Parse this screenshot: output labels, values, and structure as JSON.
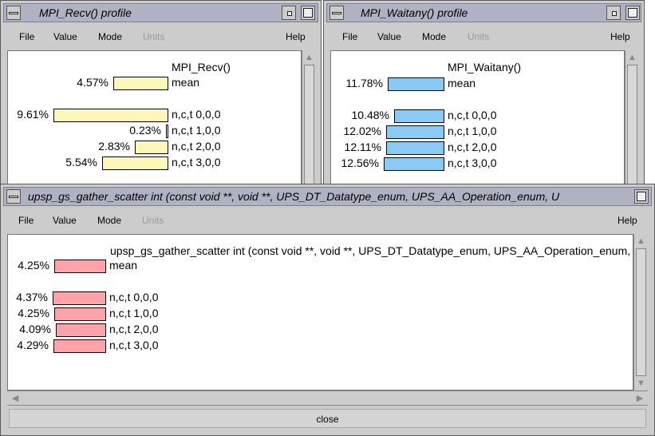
{
  "windows": {
    "recv": {
      "title": "MPI_Recv()   profile",
      "function_name": "MPI_Recv()",
      "mean": {
        "percent": "4.57%",
        "label": "mean",
        "value": 4.57
      },
      "rows": [
        {
          "percent": "9.61%",
          "label": "n,c,t 0,0,0",
          "value": 9.61
        },
        {
          "percent": "0.23%",
          "label": "n,c,t 1,0,0",
          "value": 0.23
        },
        {
          "percent": "2.83%",
          "label": "n,c,t 2,0,0",
          "value": 2.83
        },
        {
          "percent": "5.54%",
          "label": "n,c,t 3,0,0",
          "value": 5.54
        }
      ],
      "bar_color": "#fff7b8"
    },
    "waitany": {
      "title": "MPI_Waitany()   profile",
      "function_name": "MPI_Waitany()",
      "mean": {
        "percent": "11.78%",
        "label": "mean",
        "value": 11.78
      },
      "rows": [
        {
          "percent": "10.48%",
          "label": "n,c,t 0,0,0",
          "value": 10.48
        },
        {
          "percent": "12.02%",
          "label": "n,c,t 1,0,0",
          "value": 12.02
        },
        {
          "percent": "12.11%",
          "label": "n,c,t 2,0,0",
          "value": 12.11
        },
        {
          "percent": "12.56%",
          "label": "n,c,t 3,0,0",
          "value": 12.56
        }
      ],
      "bar_color": "#89cbf7"
    },
    "gather": {
      "title": "upsp_gs_gather_scatter int (const void **, void **, UPS_DT_Datatype_enum, UPS_AA_Operation_enum, U",
      "function_name": "upsp_gs_gather_scatter int (const void **, void **, UPS_DT_Datatype_enum, UPS_AA_Operation_enum, UPS_A",
      "mean": {
        "percent": "4.25%",
        "label": "mean",
        "value": 4.25
      },
      "rows": [
        {
          "percent": "4.37%",
          "label": "n,c,t 0,0,0",
          "value": 4.37
        },
        {
          "percent": "4.25%",
          "label": "n,c,t 1,0,0",
          "value": 4.25
        },
        {
          "percent": "4.09%",
          "label": "n,c,t 2,0,0",
          "value": 4.09
        },
        {
          "percent": "4.29%",
          "label": "n,c,t 3,0,0",
          "value": 4.29
        }
      ],
      "bar_color": "#ffa3a8",
      "close_label": "close"
    }
  },
  "menu": {
    "file": "File",
    "value": "Value",
    "mode": "Mode",
    "units": "Units",
    "help": "Help"
  }
}
